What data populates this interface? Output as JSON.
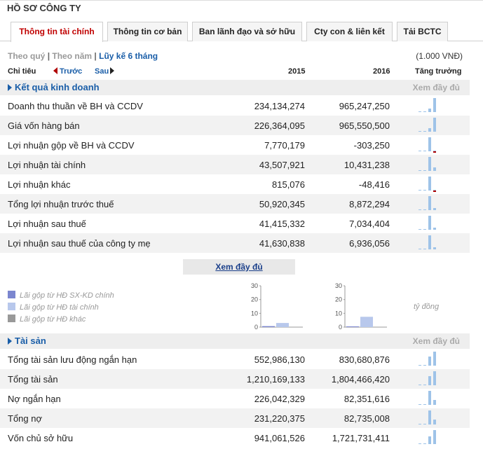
{
  "page": {
    "title": "HỒ SƠ CÔNG TY"
  },
  "tabs": [
    {
      "label": "Thông tin tài chính",
      "active": true
    },
    {
      "label": "Thông tin cơ bản",
      "active": false
    },
    {
      "label": "Ban lãnh đạo và sở hữu",
      "active": false
    },
    {
      "label": "Cty con & liên kết",
      "active": false
    },
    {
      "label": "Tải BCTC",
      "active": false
    }
  ],
  "filters": {
    "quarter": "Theo quý",
    "year": "Theo năm",
    "cumulative": "Lũy kế 6 tháng",
    "separator": "|",
    "unit": "(1.000 VNĐ)"
  },
  "table_header": {
    "indicator": "Chỉ tiêu",
    "prev": "Trước",
    "next": "Sau",
    "year1": "2015",
    "year2": "2016",
    "growth": "Tăng trưởng"
  },
  "sections": {
    "business": {
      "title": "Kết quả kinh doanh",
      "more": "Xem đầy đủ",
      "rows": [
        {
          "name": "Doanh thu thuần về BH và CCDV",
          "v1": "234,134,274",
          "v2": "965,247,250",
          "n1": 234134274,
          "n2": 965247250
        },
        {
          "name": "Giá vốn hàng bán",
          "v1": "226,364,095",
          "v2": "965,550,500",
          "n1": 226364095,
          "n2": 965550500
        },
        {
          "name": "Lợi nhuận gộp về BH và CCDV",
          "v1": "7,770,179",
          "v2": "-303,250",
          "n1": 7770179,
          "n2": -303250
        },
        {
          "name": "Lợi nhuận tài chính",
          "v1": "43,507,921",
          "v2": "10,431,238",
          "n1": 43507921,
          "n2": 10431238
        },
        {
          "name": "Lợi nhuận khác",
          "v1": "815,076",
          "v2": "-48,416",
          "n1": 815076,
          "n2": -48416
        },
        {
          "name": "Tổng lợi nhuận trước thuế",
          "v1": "50,920,345",
          "v2": "8,872,294",
          "n1": 50920345,
          "n2": 8872294
        },
        {
          "name": "Lợi nhuận sau thuế",
          "v1": "41,415,332",
          "v2": "7,034,404",
          "n1": 41415332,
          "n2": 7034404
        },
        {
          "name": "Lợi nhuận sau thuế của công ty mẹ",
          "v1": "41,630,838",
          "v2": "6,936,056",
          "n1": 41630838,
          "n2": 6936056
        }
      ]
    },
    "assets": {
      "title": "Tài sản",
      "more": "Xem đầy đủ",
      "rows": [
        {
          "name": "Tổng tài sản lưu động ngắn hạn",
          "v1": "552,986,130",
          "v2": "830,680,876",
          "n1": 552986130,
          "n2": 830680876
        },
        {
          "name": "Tổng tài sản",
          "v1": "1,210,169,133",
          "v2": "1,804,466,420",
          "n1": 1210169133,
          "n2": 1804466420
        },
        {
          "name": "Nợ ngắn hạn",
          "v1": "226,042,329",
          "v2": "82,351,616",
          "n1": 226042329,
          "n2": 82351616
        },
        {
          "name": "Tổng nợ",
          "v1": "231,220,375",
          "v2": "82,735,008",
          "n1": 231220375,
          "n2": 82735008
        },
        {
          "name": "Vốn chủ sở hữu",
          "v1": "941,061,526",
          "v2": "1,721,731,411",
          "n1": 941061526,
          "n2": 1721731411
        }
      ]
    }
  },
  "see_all_button": "Xem đầy đủ",
  "legend": [
    {
      "label": "Lãi gộp từ HĐ SX-KD chính",
      "color": "#7b86cf"
    },
    {
      "label": "Lãi gộp từ HĐ tài chính",
      "color": "#b8c8ec"
    },
    {
      "label": "Lãi gộp từ HĐ khác",
      "color": "#999999"
    }
  ],
  "chart_unit": "tỷ đồng",
  "colors": {
    "accent": "#1a5ea8",
    "active_tab": "#c00000",
    "spark_bar": "#9ec3e8",
    "negative": "#b00000"
  },
  "chart_data": [
    {
      "type": "bar",
      "ylim": [
        0,
        30
      ],
      "yticks": [
        0,
        10,
        20,
        30
      ],
      "series": [
        {
          "values": [
            0.7,
            3
          ]
        }
      ],
      "colors": [
        "#7b86cf",
        "#b8c8ec"
      ]
    },
    {
      "type": "bar",
      "ylim": [
        0,
        30
      ],
      "yticks": [
        0,
        10,
        20,
        30
      ],
      "series": [
        {
          "values": [
            0,
            7.5
          ]
        }
      ],
      "colors": [
        "#7b86cf",
        "#b8c8ec"
      ]
    }
  ]
}
